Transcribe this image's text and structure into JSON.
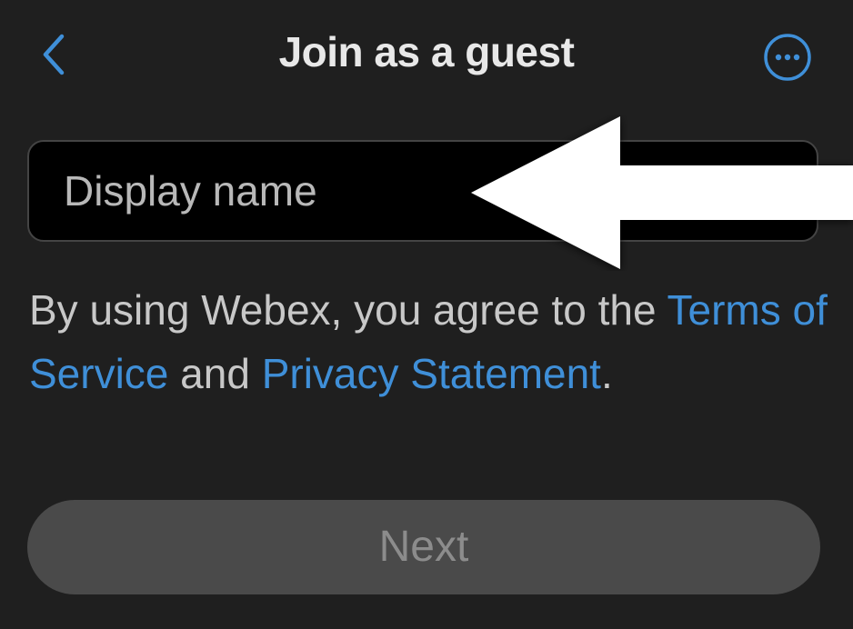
{
  "header": {
    "title": "Join as a guest",
    "back_icon": "chevron-left-icon",
    "more_icon": "more-options-icon"
  },
  "form": {
    "display_name_placeholder": "Display name",
    "display_name_value": ""
  },
  "legal": {
    "prefix": "By using Webex, you agree to the ",
    "terms_link": "Terms of Service",
    "middle": " and ",
    "privacy_link": "Privacy Statement",
    "suffix": "."
  },
  "next_button": {
    "label": "Next",
    "enabled": false
  },
  "annotation": {
    "arrow_icon": "white-arrow-left-icon"
  },
  "colors": {
    "background": "#1f1f1f",
    "accent_link": "#3f8fd8",
    "button_disabled_bg": "#4a4a4a",
    "button_disabled_text": "#8c8c8c"
  }
}
